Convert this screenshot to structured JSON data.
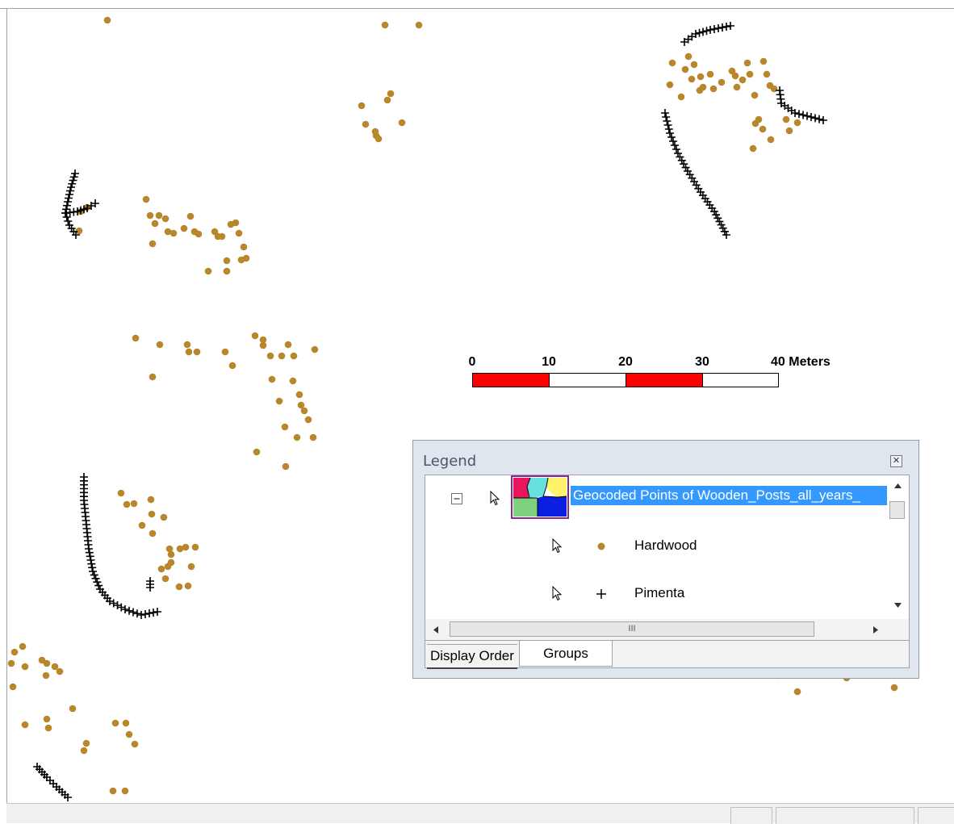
{
  "scale_bar": {
    "ticks": [
      "0",
      "10",
      "20",
      "30",
      "40 Meters"
    ],
    "colors": {
      "filled": "#ff0000",
      "empty": "#ffffff"
    }
  },
  "map": {
    "symbol_colors": {
      "hardwood": "#b8862b",
      "pimenta": "#000000"
    }
  },
  "legend": {
    "title": "Legend",
    "close_icon": "close-icon",
    "group": {
      "collapse_icon": "minus-box-icon",
      "label": "Geocoded Points of Wooden_Posts_all_years_"
    },
    "items": [
      {
        "label": "Hardwood",
        "symbol": "dot-icon"
      },
      {
        "label": "Pimenta",
        "symbol": "plus-icon"
      }
    ],
    "scroll_grip": "III",
    "tabs": [
      "Display Order",
      "Groups"
    ],
    "active_tab": "Groups"
  }
}
